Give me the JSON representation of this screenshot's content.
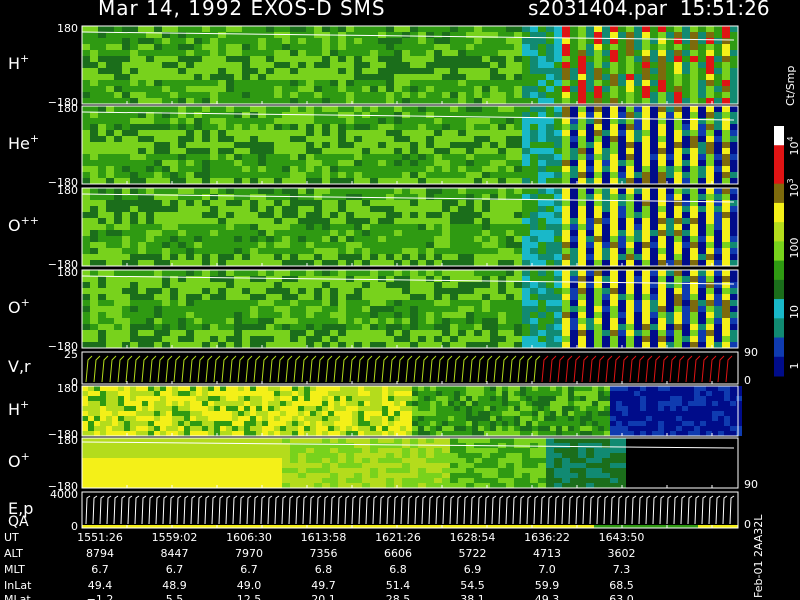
{
  "header": {
    "title": "Mar 14, 1992    EXOS-D SMS",
    "file": "s2031404.par",
    "time": "15:51:26"
  },
  "colors": {
    "background": "#000000",
    "white": "#ffffff",
    "navy": "#000c8a",
    "blue": "#0f3bb0",
    "cyan": "#19b8c9",
    "teal": "#118a72",
    "darkgreen": "#1b6e1b",
    "green": "#2f9a12",
    "lime": "#78d21c",
    "yellowgreen": "#b4dc1c",
    "yellow": "#f4f018",
    "olive": "#7d6a0c",
    "red": "#e01414"
  },
  "chart_data": {
    "type": "heatmap",
    "panels": [
      {
        "label_base": "H",
        "label_sup": "+",
        "ymax": "180",
        "ymin": "−180"
      },
      {
        "label_base": "He",
        "label_sup": "+",
        "ymax": "180",
        "ymin": "−180"
      },
      {
        "label_base": "O",
        "label_sup": "++",
        "ymax": "180",
        "ymin": "−180"
      },
      {
        "label_base": "O",
        "label_sup": "+",
        "ymax": "180",
        "ymin": "−180"
      },
      {
        "label_base": "V,r",
        "label_sup": "",
        "ymax": "25",
        "ymin": "0",
        "right_top": "90",
        "right_bottom": "0"
      },
      {
        "label_base": "H",
        "label_sup": "+",
        "ymax": "180",
        "ymin": "−180"
      },
      {
        "label_base": "O",
        "label_sup": "+",
        "ymax": "180",
        "ymin": "−180",
        "right_bottom": "90"
      },
      {
        "label_base": "E,p",
        "label_sup": "",
        "label2": "QA",
        "ymax": "4000",
        "ymin": "0",
        "right_bottom": "0"
      }
    ],
    "colorbar": {
      "unit": "Ct/Smp",
      "ticks": [
        {
          "base": "10",
          "sup": "4",
          "value": 10000
        },
        {
          "base": "10",
          "sup": "3",
          "value": 1000
        },
        {
          "base": "100",
          "sup": "",
          "value": 100
        },
        {
          "base": "10",
          "sup": "",
          "value": 10
        },
        {
          "base": "1",
          "sup": "",
          "value": 1
        }
      ]
    },
    "orbit_table": {
      "headers": [
        "UT",
        "ALT",
        "MLT",
        "InLat",
        "MLat"
      ],
      "columns": [
        [
          "1551:26",
          "8794",
          "6.7",
          "49.4",
          "−1.2"
        ],
        [
          "1559:02",
          "8447",
          "6.7",
          "48.9",
          "5.5"
        ],
        [
          "1606:30",
          "7970",
          "6.7",
          "49.0",
          "12.5"
        ],
        [
          "1613:58",
          "7356",
          "6.8",
          "49.7",
          "20.1"
        ],
        [
          "1621:26",
          "6606",
          "6.8",
          "51.4",
          "28.5"
        ],
        [
          "1628:54",
          "5722",
          "6.9",
          "54.5",
          "38.1"
        ],
        [
          "1636:22",
          "4713",
          "7.0",
          "59.9",
          "49.3"
        ],
        [
          "1643:50",
          "3602",
          "7.3",
          "68.5",
          "63.0"
        ]
      ]
    }
  },
  "footer": {
    "stamp": "Feb-01 2AA32L"
  }
}
